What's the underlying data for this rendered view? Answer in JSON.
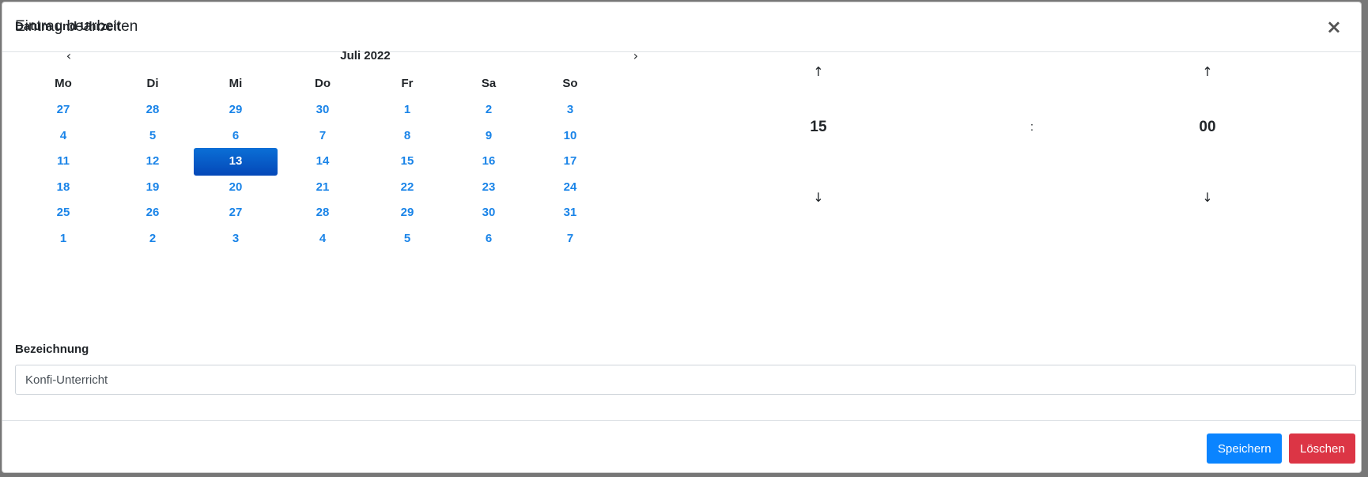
{
  "modal": {
    "title": "Eintrag bearbeiten",
    "close_label": "×"
  },
  "datetime": {
    "label": "Datum und Uhrzeit",
    "calendar": {
      "prev_icon": "‹",
      "next_icon": "›",
      "month_label": "Juli 2022",
      "weekdays": [
        "Mo",
        "Di",
        "Mi",
        "Do",
        "Fr",
        "Sa",
        "So"
      ],
      "weeks": [
        [
          "27",
          "28",
          "29",
          "30",
          "1",
          "2",
          "3"
        ],
        [
          "4",
          "5",
          "6",
          "7",
          "8",
          "9",
          "10"
        ],
        [
          "11",
          "12",
          "13",
          "14",
          "15",
          "16",
          "17"
        ],
        [
          "18",
          "19",
          "20",
          "21",
          "22",
          "23",
          "24"
        ],
        [
          "25",
          "26",
          "27",
          "28",
          "29",
          "30",
          "31"
        ],
        [
          "1",
          "2",
          "3",
          "4",
          "5",
          "6",
          "7"
        ]
      ],
      "selected_day": "13"
    },
    "time": {
      "up_icon": "↑",
      "down_icon": "↓",
      "hour": "15",
      "separator": ":",
      "minute": "00"
    }
  },
  "title_field": {
    "label": "Bezeichnung",
    "value": "Konfi-Unterricht"
  },
  "footer": {
    "save_label": "Speichern",
    "delete_label": "Löschen"
  },
  "colors": {
    "accent": "#0a84ff",
    "day_link": "#1a84e8",
    "danger": "#dc3545",
    "selected_bg": "#0548b8"
  }
}
